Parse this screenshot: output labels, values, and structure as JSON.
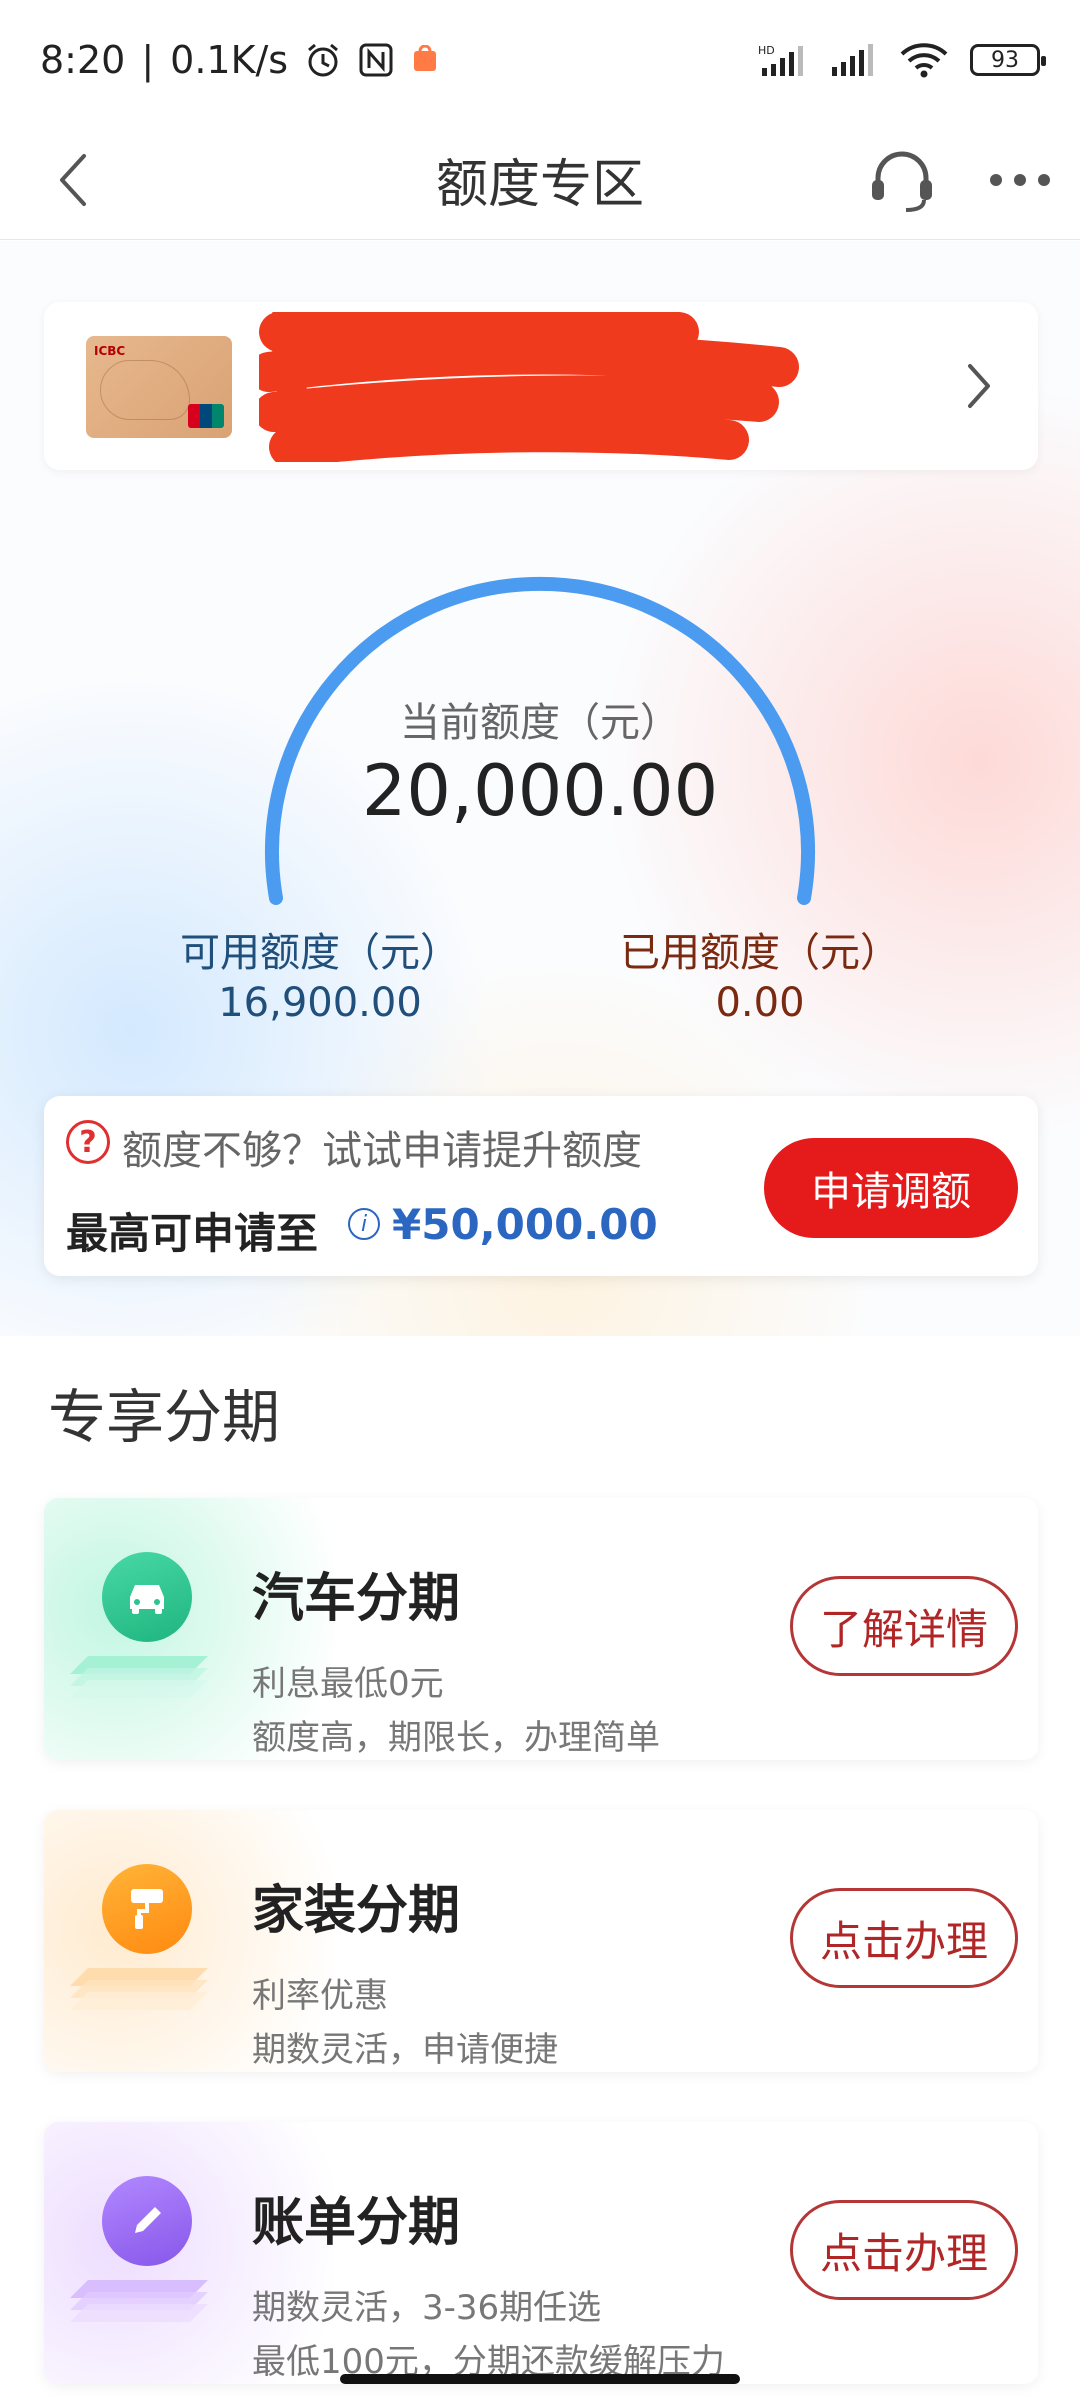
{
  "status_bar": {
    "time": "8:20",
    "network_speed": "0.1K/s",
    "battery": "93",
    "icons": [
      "alarm-icon",
      "nfc-icon",
      "app-notification-icon",
      "hd-signal-icon",
      "signal-icon",
      "wifi-icon",
      "battery-icon"
    ]
  },
  "header": {
    "title": "额度专区",
    "back_icon": "chevron-left-icon",
    "support_icon": "headset-icon",
    "more_icon": "more-horizontal-icon"
  },
  "card": {
    "card_logo_text": "ICBC",
    "name_redacted": true
  },
  "gauge": {
    "label": "当前额度（元）",
    "value": "20,000.00",
    "color": "#4b9bf0"
  },
  "available": {
    "label": "可用额度（元）",
    "value": "16,900.00"
  },
  "used": {
    "label": "已用额度（元）",
    "value": "0.00"
  },
  "increase": {
    "tip": "额度不够？试试申请提升额度",
    "max_label": "最高可申请至",
    "max_amount": "¥50,000.00",
    "button": "申请调额"
  },
  "section": {
    "title": "专享分期"
  },
  "items": [
    {
      "title": "汽车分期",
      "line1": "利息最低0元",
      "line2": "额度高，期限长，办理简单",
      "button": "了解详情",
      "icon": "car-icon",
      "color": "#2cc392"
    },
    {
      "title": "家装分期",
      "line1": "利率优惠",
      "line2": "期数灵活，申请便捷",
      "button": "点击办理",
      "icon": "paint-roller-icon",
      "color": "#ff9a1e"
    },
    {
      "title": "账单分期",
      "line1": "期数灵活，3-36期任选",
      "line2": "最低100元，分期还款缓解压力",
      "button": "点击办理",
      "icon": "pencil-icon",
      "color": "#9a6cf0"
    }
  ]
}
